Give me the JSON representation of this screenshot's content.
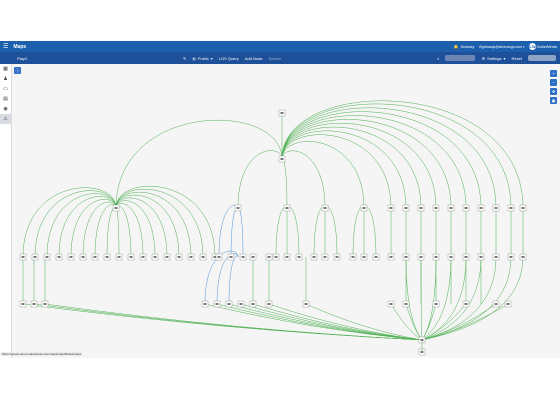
{
  "topbar": {
    "title": "Maps",
    "notifications_label": "Nobody",
    "user_label": "flighbacqk@silverdugs.com",
    "brand": "SolarWinds",
    "brand_short": "S.W"
  },
  "subbar": {
    "map_name": "PlayC",
    "privacy_label": "Public",
    "query_label": "LOS Query",
    "add_node_label": "Add Node",
    "search_placeholder": "Search",
    "settings_label": "Settings",
    "reset_label": "Reset",
    "search2_placeholder": "",
    "layout_placeholder": ""
  },
  "status_url": "https://space-demo.solarwinds.com/maps/map/#/beta/maps",
  "colors": {
    "edge_green": "#4caf50",
    "edge_blue": "#4a8fd9",
    "nav": "#1b5fad",
    "subnav": "#1e4f99"
  }
}
